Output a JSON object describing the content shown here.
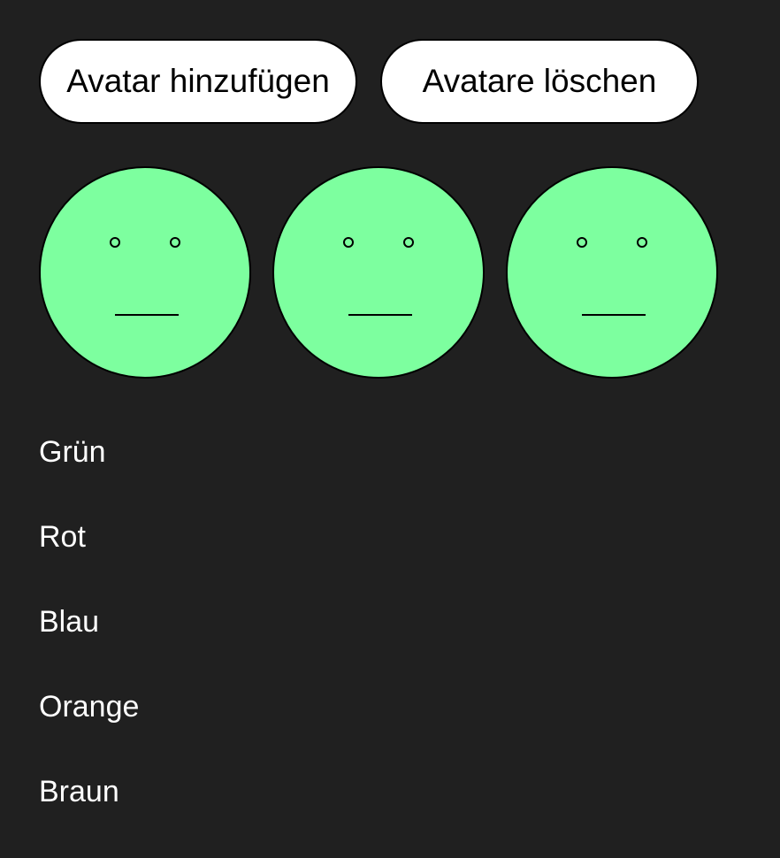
{
  "toolbar": {
    "add_label": "Avatar hinzufügen",
    "delete_label": "Avatare löschen"
  },
  "avatars": {
    "count": 3,
    "fill_color": "#7dff9f",
    "expression": "neutral-face"
  },
  "colors": {
    "items": [
      "Grün",
      "Rot",
      "Blau",
      "Orange",
      "Braun"
    ]
  },
  "theme": {
    "background": "#202020",
    "button_bg": "#ffffff",
    "text": "#ffffff"
  }
}
